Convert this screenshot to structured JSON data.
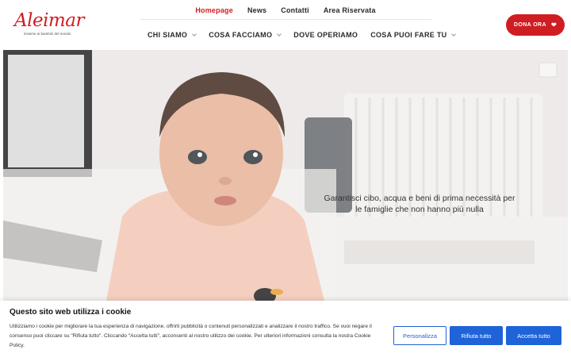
{
  "header": {
    "logo_text": "Aleimar",
    "logo_tagline": "insieme ai bambini del mondo",
    "top_nav": [
      {
        "label": "Homepage",
        "active": true
      },
      {
        "label": "News",
        "active": false
      },
      {
        "label": "Contatti",
        "active": false
      },
      {
        "label": "Area Riservata",
        "active": false
      }
    ],
    "main_nav": [
      {
        "label": "CHI SIAMO",
        "has_dropdown": true
      },
      {
        "label": "COSA FACCIAMO",
        "has_dropdown": true
      },
      {
        "label": "DOVE OPERIAMO",
        "has_dropdown": false
      },
      {
        "label": "COSA PUOI FARE TU",
        "has_dropdown": true
      }
    ],
    "donate_label": "DONA ORA",
    "donate_icon": "heart-icon",
    "brand_color": "#d01d22"
  },
  "hero": {
    "caption": "Garantisci cibo, acqua e beni di prima necessità per le famiglie che non hanno più nulla"
  },
  "cookie_banner": {
    "title": "Questo sito web utilizza i cookie",
    "text": "Utilizziamo i cookie per migliorare la tua esperienza di navigazione, offrirti pubblicità o contenuti personalizzati e analizzare il nostro traffico. Se vuoi negare il consenso puoi cliccare su \"Rifiuta tutto\". Cliccando \"Accetta tutti\", acconsenti al nostro utilizzo dei cookie. Per ulteriori informazioni consulta la nostra Cookie Policy.",
    "customize_label": "Personalizza",
    "reject_label": "Rifiuta tutto",
    "accept_label": "Accetta tutto",
    "button_color": "#1e63d8"
  }
}
